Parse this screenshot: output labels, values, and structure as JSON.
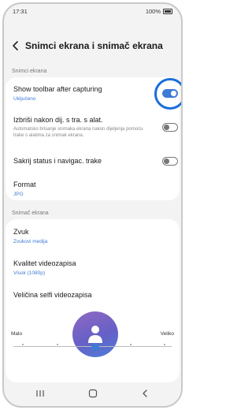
{
  "status": {
    "time": "17:31",
    "battery": "100%"
  },
  "header": {
    "title": "Snimci ekrana i snimač ekrana"
  },
  "sections": {
    "screenshots": {
      "label": "Snimci ekrana",
      "items": [
        {
          "title": "Show toolbar after capturing",
          "subtitle": "Uključeno",
          "toggle": true
        },
        {
          "title": "Izbriši nakon dij. s tra. s alat.",
          "description": "Automatsko brisanje snimaka ekrana nakon dijeljenja pomoću trake s alatima za snimak ekrana.",
          "toggle": false
        },
        {
          "title": "Sakrij status i navigac. trake",
          "toggle": false
        },
        {
          "title": "Format",
          "subtitle": "JPG"
        }
      ]
    },
    "recorder": {
      "label": "Snimač ekrana",
      "items": [
        {
          "title": "Zvuk",
          "subtitle": "Zvukovi medija"
        },
        {
          "title": "Kvalitet videozapisa",
          "subtitle": "Visok (1080p)"
        },
        {
          "title": "Veličina selfi videozapisa"
        }
      ],
      "slider": {
        "min_label": "Malo",
        "max_label": "Veliko",
        "value_fraction": 0.5
      }
    }
  },
  "colors": {
    "accent": "#3e7ad6",
    "highlight_ring": "#1a6ed8",
    "background": "#f3f3f3",
    "card": "#ffffff"
  },
  "icons": {
    "back": "chevron-left-icon",
    "recents": "recent-apps-icon",
    "home": "home-icon",
    "nav_back": "back-icon",
    "avatar": "person-icon"
  }
}
